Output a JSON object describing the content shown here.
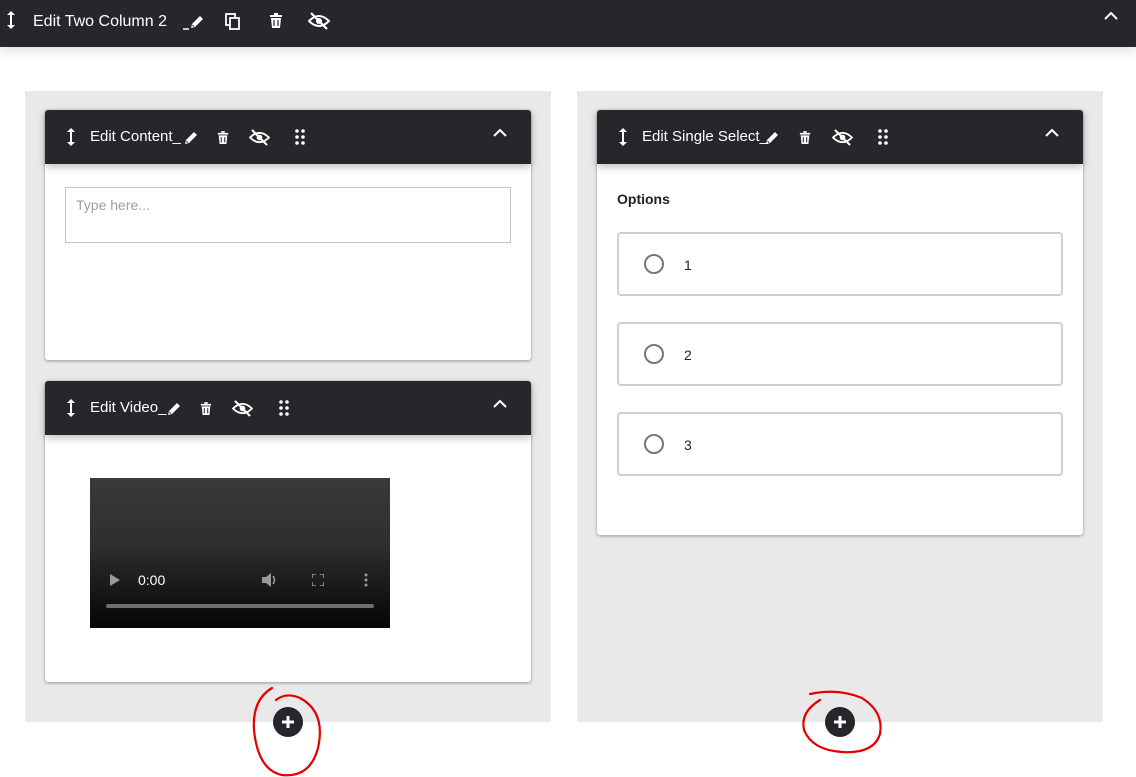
{
  "topbar": {
    "title": "Edit Two Column 2",
    "icons": [
      "move-vertical-icon",
      "pencil-icon",
      "copy-icon",
      "trash-icon",
      "eye-off-icon",
      "chevron-up-icon"
    ]
  },
  "left_column": {
    "content_card": {
      "title": "Edit Content_",
      "placeholder": "Type here..."
    },
    "video_card": {
      "title": "Edit Video_",
      "time": "0:00",
      "progress": 0
    }
  },
  "right_column": {
    "select_card": {
      "title": "Edit Single Select_",
      "options_label": "Options",
      "options": [
        "1",
        "2",
        "3"
      ]
    }
  },
  "colors": {
    "header_bg": "#25272a",
    "column_bg": "#e8e9e8",
    "annotation": "#e30000"
  }
}
